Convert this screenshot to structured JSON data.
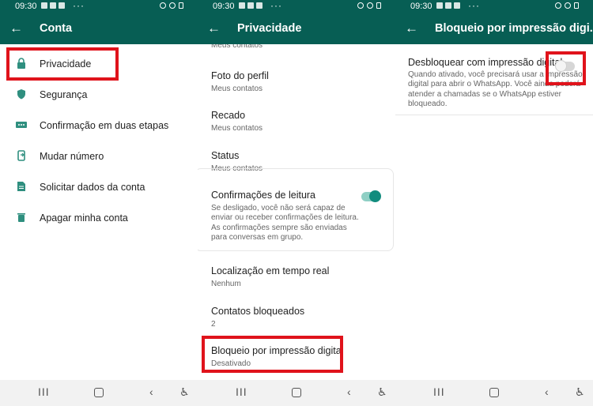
{
  "status": {
    "time": "09:30",
    "dots": "···"
  },
  "panels": [
    {
      "title": "Conta",
      "items": [
        {
          "label": "Privacidade",
          "icon": "lock-icon"
        },
        {
          "label": "Segurança",
          "icon": "shield-icon"
        },
        {
          "label": "Confirmação em duas etapas",
          "icon": "dots-icon"
        },
        {
          "label": "Mudar número",
          "icon": "phone-swap-icon"
        },
        {
          "label": "Solicitar dados da conta",
          "icon": "document-icon"
        },
        {
          "label": "Apagar minha conta",
          "icon": "trash-icon"
        }
      ]
    },
    {
      "title": "Privacidade",
      "partial_subtitle": "Meus contatos",
      "items": [
        {
          "title": "Foto do perfil",
          "subtitle": "Meus contatos"
        },
        {
          "title": "Recado",
          "subtitle": "Meus contatos"
        },
        {
          "title": "Status",
          "subtitle": "Meus contatos"
        },
        {
          "title": "Confirmações de leitura",
          "subtitle": "Se desligado, você não será capaz de enviar ou receber confirmações de leitura. As confirmações sempre são enviadas para conversas em grupo.",
          "toggle": true
        },
        {
          "title": "Localização em tempo real",
          "subtitle": "Nenhum"
        },
        {
          "title": "Contatos bloqueados",
          "subtitle": "2"
        },
        {
          "title": "Bloqueio por impressão digital",
          "subtitle": "Desativado"
        }
      ]
    },
    {
      "title": "Bloqueio por impressão digi...",
      "setting": {
        "title": "Desbloquear com impressão digital",
        "description": "Quando ativado, você precisará usar a impressão digital para abrir o WhatsApp. Você ainda poderá atender a chamadas se o WhatsApp estiver bloqueado.",
        "toggle": false
      }
    }
  ],
  "colors": {
    "header": "#075e54",
    "accent": "#128c7e",
    "highlight": "#e0131b"
  },
  "navbar": {
    "recent": "III",
    "back": "‹",
    "accessibility": "♿"
  }
}
